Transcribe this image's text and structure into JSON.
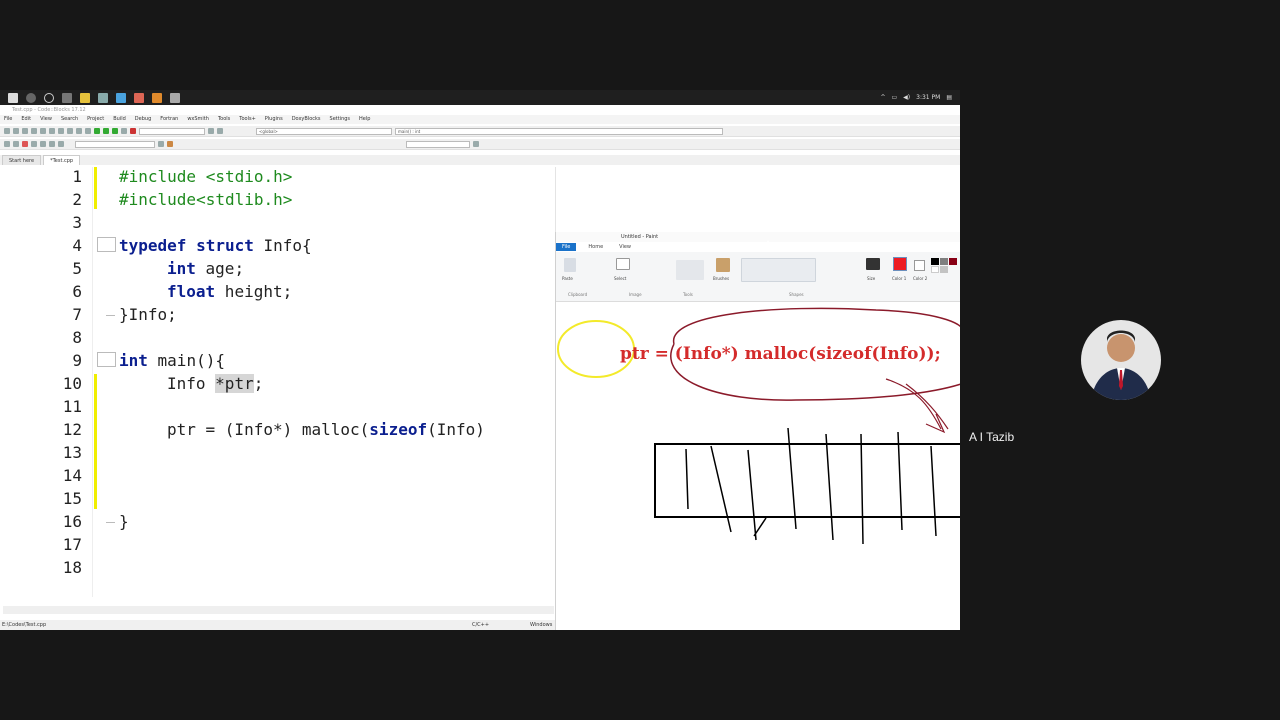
{
  "taskbar": {
    "time": "3:31 PM"
  },
  "codeblocks": {
    "title": "Test.cpp - Code::Blocks 17.12",
    "menu": [
      "File",
      "Edit",
      "View",
      "Search",
      "Project",
      "Build",
      "Debug",
      "Fortran",
      "wxSmith",
      "Tools",
      "Tools+",
      "Plugins",
      "DoxyBlocks",
      "Settings",
      "Help"
    ],
    "scope_select": "<global>",
    "symbol_select": "main() : int",
    "tabs": [
      "Start here",
      "*Test.cpp"
    ],
    "status": {
      "path": "E:\\Codes\\Test.cpp",
      "language": "C/C++",
      "line_endings": "Windows"
    }
  },
  "editor": {
    "line_numbers": [
      "1",
      "2",
      "3",
      "4",
      "5",
      "6",
      "7",
      "8",
      "9",
      "10",
      "11",
      "12",
      "13",
      "14",
      "15",
      "16",
      "17",
      "18"
    ],
    "lines": {
      "l1": "#include <stdio.h>",
      "l2": "#include<stdlib.h>",
      "l4_kw1": "typedef",
      "l4_kw2": "struct",
      "l4_rest": " Info{",
      "l5_kw": "int",
      "l5_rest": " age;",
      "l6_kw": "float",
      "l6_rest": " height;",
      "l7": "}Info;",
      "l9_kw": "int",
      "l9_rest": " main(){",
      "l10_a": "Info ",
      "l10_b": "*ptr",
      "l10_c": ";",
      "l12_a": "ptr = (Info*) malloc(",
      "l12_kw": "sizeof",
      "l12_b": "(Info)",
      "l16": "}"
    }
  },
  "paint": {
    "title": "Untitled - Paint",
    "tabs": [
      "File",
      "Home",
      "View"
    ],
    "groups": [
      "Clipboard",
      "Image",
      "Tools",
      "Shapes"
    ],
    "buttons": {
      "paste": "Paste",
      "select": "Select",
      "brushes": "Brushes",
      "size": "Size",
      "color1": "Color 1",
      "color2": "Color 2"
    },
    "canvas_formula": "ptr = (Info*) malloc(sizeof(Info));",
    "accent": "#d42b2b"
  },
  "participant": {
    "name": "A I Tazib"
  }
}
